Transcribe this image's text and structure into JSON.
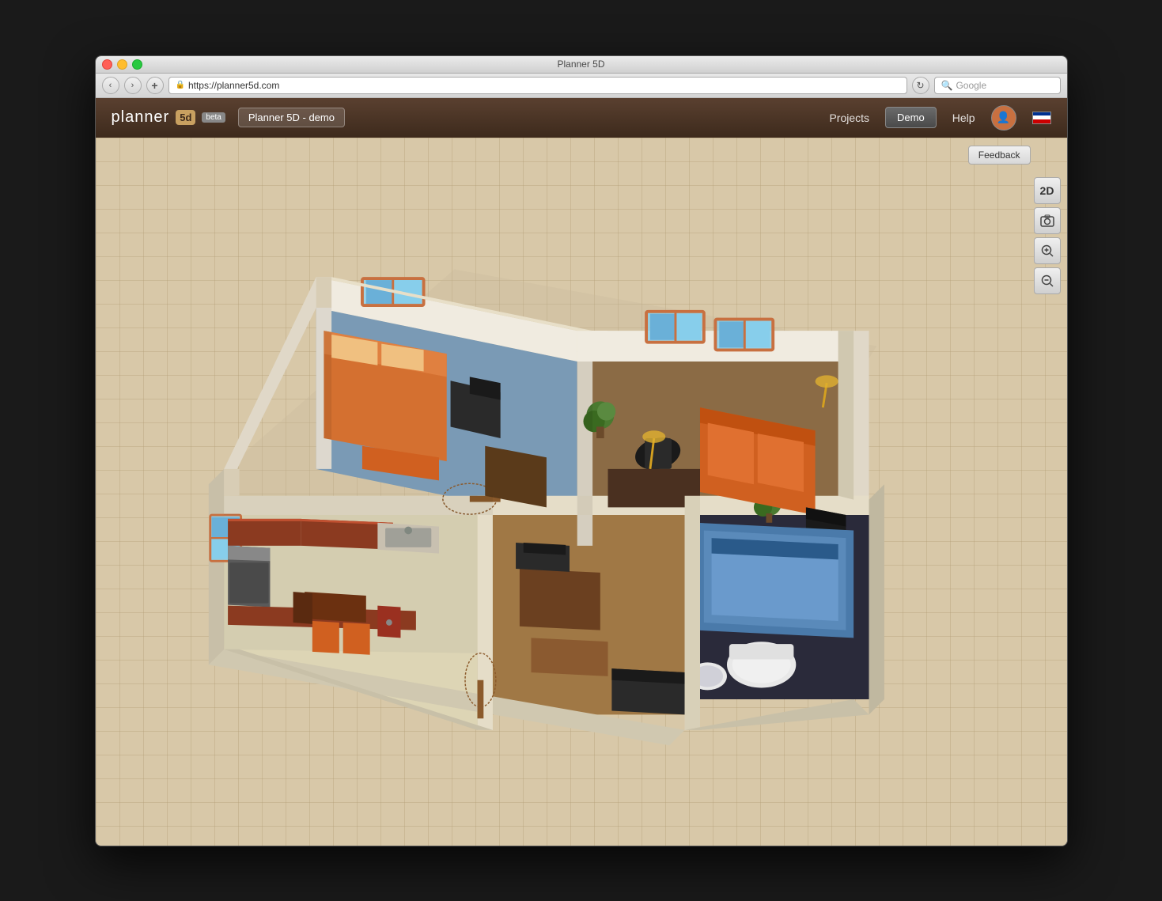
{
  "window": {
    "title": "Planner 5D",
    "close_btn": "×",
    "min_btn": "−",
    "max_btn": "+"
  },
  "browser": {
    "url": "https://planner5d.com",
    "url_icon": "🔒",
    "search_placeholder": "Google",
    "nav_back": "‹",
    "nav_forward": "›",
    "add_tab": "+",
    "refresh": "↻"
  },
  "header": {
    "logo_text": "planner",
    "logo_box": "5d",
    "beta": "beta",
    "project_title": "Planner 5D - demo",
    "nav_projects": "Projects",
    "nav_demo": "Demo",
    "nav_help": "Help"
  },
  "toolbar": {
    "view_2d": "2D",
    "screenshot": "📷",
    "zoom_in": "🔍+",
    "zoom_out": "🔍−",
    "feedback": "Feedback"
  },
  "scene": {
    "description": "3D isometric floor plan with multiple rooms",
    "rooms": [
      "bedroom",
      "office",
      "kitchen",
      "bathroom",
      "living_room"
    ]
  }
}
